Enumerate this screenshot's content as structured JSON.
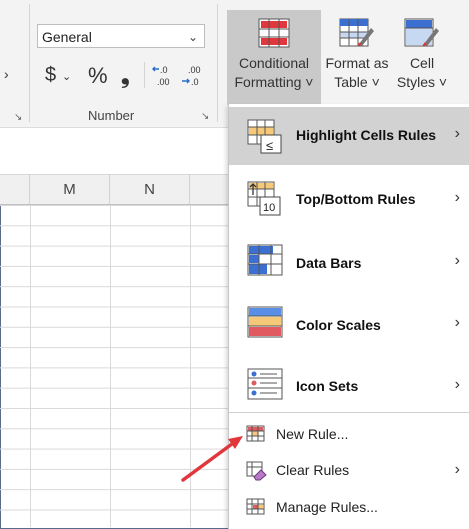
{
  "ribbon": {
    "number_format_value": "General",
    "currency_symbol": "$",
    "percent_symbol": "%",
    "comma_symbol": "❟",
    "number_group_label": "Number",
    "conditional_formatting_label_1": "Conditional",
    "conditional_formatting_label_2": "Formatting ˅",
    "format_as_table_label_1": "Format as",
    "format_as_table_label_2": "Table ˅",
    "cell_styles_label_1": "Cell",
    "cell_styles_label_2": "Styles ˅"
  },
  "columns": [
    "M",
    "N"
  ],
  "menu": {
    "items": [
      {
        "label": "Highlight Cells Rules",
        "icon": "highlight-cells-icon"
      },
      {
        "label": "Top/Bottom Rules",
        "icon": "top-bottom-icon"
      },
      {
        "label": "Data Bars",
        "icon": "data-bars-icon"
      },
      {
        "label": "Color Scales",
        "icon": "color-scales-icon"
      },
      {
        "label": "Icon Sets",
        "icon": "icon-sets-icon"
      }
    ],
    "small_items": [
      {
        "label": "New Rule...",
        "icon": "new-rule-icon"
      },
      {
        "label": "Clear Rules",
        "icon": "clear-rules-icon"
      },
      {
        "label": "Manage Rules...",
        "icon": "manage-rules-icon"
      }
    ]
  },
  "colors": {
    "accent_red": "#e0363c",
    "highlight": "#d2d2d2",
    "cell_blue": "#3b6fd1"
  }
}
